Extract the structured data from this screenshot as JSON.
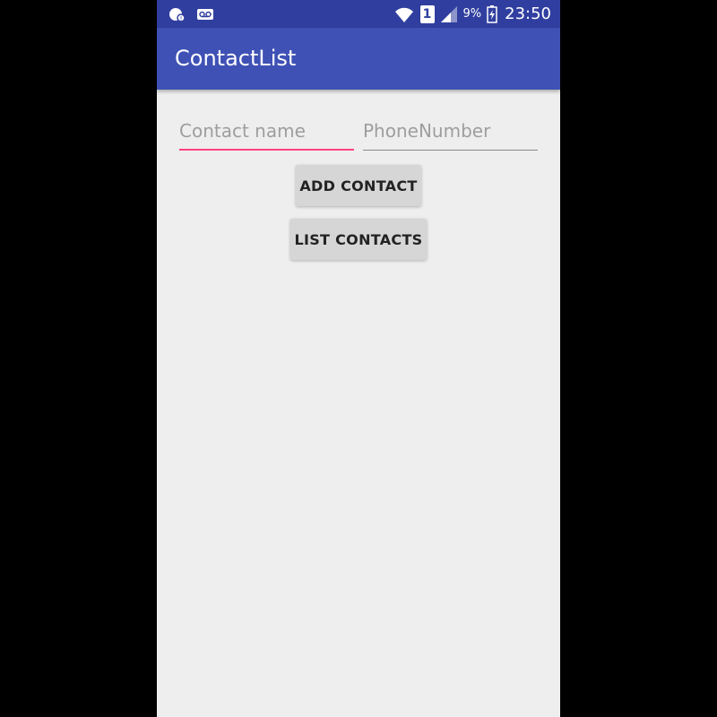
{
  "status_bar": {
    "battery_percent": "9%",
    "clock": "23:50",
    "sim_slot": "1",
    "icons": [
      "notification-badge-icon",
      "voicemail-icon",
      "wifi-icon",
      "sim-icon",
      "signal-icon",
      "battery-charging-icon"
    ]
  },
  "app_bar": {
    "title": "ContactList"
  },
  "form": {
    "name_placeholder": "Contact name",
    "name_value": "",
    "phone_placeholder": "PhoneNumber",
    "phone_value": ""
  },
  "buttons": {
    "add_label": "ADD CONTACT",
    "list_label": "LIST CONTACTS"
  },
  "colors": {
    "status_bar": "#303f9f",
    "app_bar": "#3f51b5",
    "accent": "#ff4081",
    "background": "#eeeeee"
  }
}
